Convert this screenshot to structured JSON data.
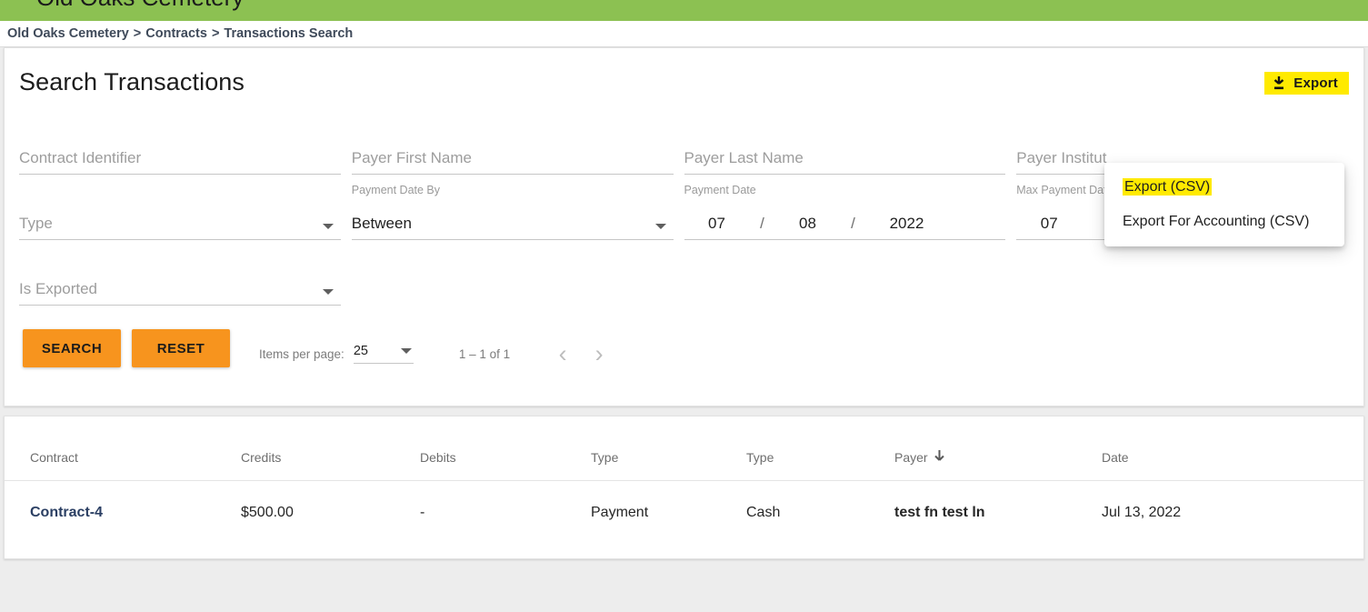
{
  "appbar": {
    "truncated_title": "Old Oaks Cemetery",
    "color": "#8cc152"
  },
  "breadcrumb": {
    "items": [
      "Old Oaks Cemetery",
      "Contracts",
      "Transactions Search"
    ],
    "separator": ">"
  },
  "header": {
    "title": "Search Transactions",
    "export_label": "Export",
    "export_icon": "download-icon",
    "export_highlight_color": "#ffea00"
  },
  "export_menu": {
    "open": true,
    "items": [
      {
        "label": "Export (CSV)",
        "highlighted": true
      },
      {
        "label": "Export For Accounting (CSV)",
        "highlighted": false
      }
    ]
  },
  "form": {
    "contract_identifier": {
      "label": "Contract Identifier",
      "value": "",
      "placeholder": "Contract Identifier"
    },
    "payer_first_name": {
      "label": "Payer First Name",
      "value": "",
      "placeholder": "Payer First Name"
    },
    "payer_last_name": {
      "label": "Payer Last Name",
      "value": "",
      "placeholder": "Payer Last Name"
    },
    "payer_institution": {
      "label": "Payer Institution",
      "value": "",
      "placeholder": "Payer Institut"
    },
    "type": {
      "label": "Type",
      "value": "",
      "placeholder": "Type"
    },
    "payment_date_by": {
      "mini_label": "Payment Date By",
      "value": "Between"
    },
    "payment_date": {
      "mini_label": "Payment Date",
      "month": "07",
      "day": "08",
      "year": "2022",
      "separator": "/"
    },
    "max_payment_date": {
      "mini_label": "Max Payment Dat",
      "month": "07"
    },
    "is_exported": {
      "label": "Is Exported",
      "value": "",
      "placeholder": "Is Exported"
    }
  },
  "actions": {
    "search_label": "SEARCH",
    "reset_label": "RESET",
    "button_color": "#f7941e"
  },
  "paginator": {
    "items_per_page_label": "Items per page:",
    "items_per_page_value": "25",
    "range_label": "1 – 1 of 1",
    "prev_icon": "chevron-left-icon",
    "next_icon": "chevron-right-icon"
  },
  "table": {
    "columns": [
      {
        "key": "contract",
        "label": "Contract",
        "sorted": false
      },
      {
        "key": "credits",
        "label": "Credits",
        "sorted": false
      },
      {
        "key": "debits",
        "label": "Debits",
        "sorted": false
      },
      {
        "key": "type1",
        "label": "Type",
        "sorted": false
      },
      {
        "key": "type2",
        "label": "Type",
        "sorted": false
      },
      {
        "key": "payer",
        "label": "Payer",
        "sorted": true,
        "sort_direction": "desc",
        "sort_icon": "arrow-down-icon"
      },
      {
        "key": "date",
        "label": "Date",
        "sorted": false
      }
    ],
    "rows": [
      {
        "contract": "Contract-4",
        "credits": "$500.00",
        "debits": "-",
        "type1": "Payment",
        "type2": "Cash",
        "payer": "test fn test ln",
        "date": "Jul 13, 2022"
      }
    ]
  }
}
